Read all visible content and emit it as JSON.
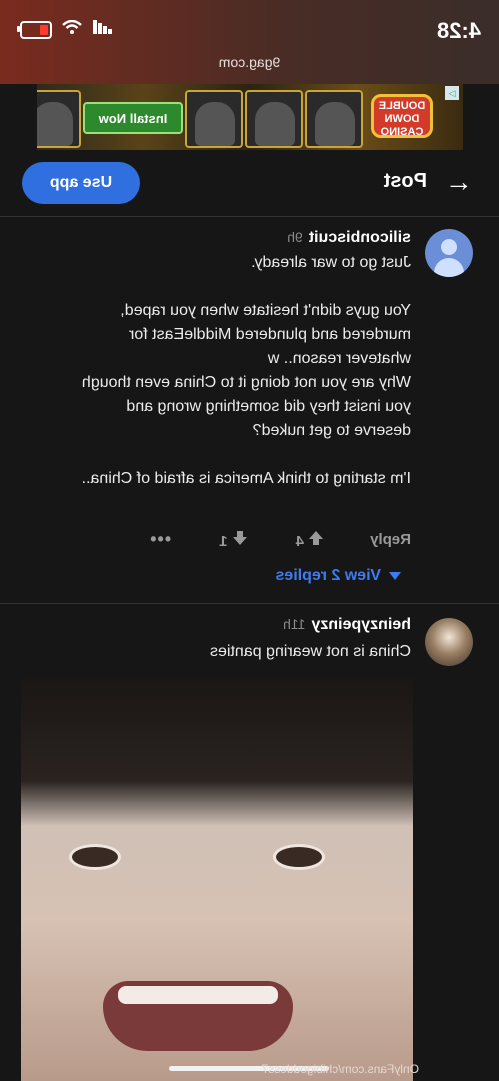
{
  "status": {
    "time": "4:28",
    "signal": "▮▮▮",
    "wifi": "wifi",
    "battery": "low"
  },
  "browser": {
    "url": "9gag.com"
  },
  "ad": {
    "install_label": "Install Now",
    "logo_text": "DOUBLE DOWN CASINO",
    "badge": "▷"
  },
  "header": {
    "back_icon": "←",
    "title": "Post",
    "use_app_label": "Use app"
  },
  "comments": [
    {
      "user": "siliconbiscuit",
      "age": "9h",
      "text": "Just go to war already.\n\nYou guys didn't hesitate when you raped,\nmurdered and plundered MiddleEast for\nwhatever reason.. w\nWhy are you not doing it to China even though\nyou insist they did something wrong and\ndeserve to get nuked?\n\nI'm starting to think America is afraid of China..",
      "reply_label": "Reply",
      "upvotes": "4",
      "downvotes": "1",
      "more": "•••",
      "view_replies": "View 2 replies"
    },
    {
      "user": "heinzypeinzy",
      "age": "11h",
      "text": "China is not wearing panties",
      "watermark": "OnlyFans.com/chibigoddess7"
    }
  ],
  "colors": {
    "accent": "#2f6fe0",
    "link": "#3d7bf0",
    "background": "#161616"
  }
}
